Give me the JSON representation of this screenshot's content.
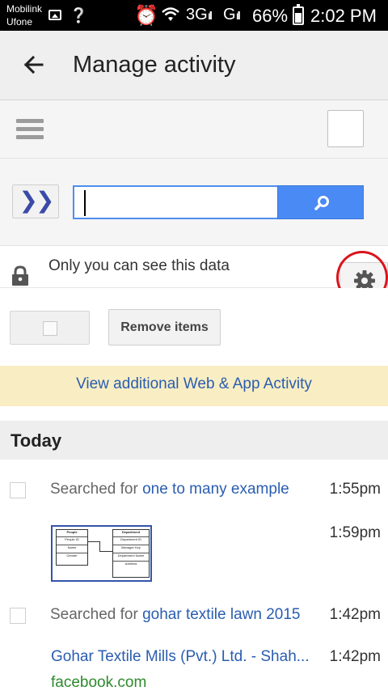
{
  "status_bar": {
    "carrier_line1": "Mobilink",
    "carrier_line2": "Ufone",
    "network_3g": "3G",
    "network_g": "G",
    "battery": "66%",
    "time": "2:02 PM"
  },
  "app_bar": {
    "title": "Manage activity"
  },
  "privacy": {
    "text": "Only you can see this data"
  },
  "actions": {
    "remove_label": "Remove items"
  },
  "banner": {
    "link": "View additional Web & App Activity"
  },
  "day_header": "Today",
  "items": [
    {
      "prefix": "Searched for ",
      "query": "one to many example",
      "time": "1:55pm"
    },
    {
      "time": "1:59pm"
    },
    {
      "prefix": "Searched for ",
      "query": "gohar textile lawn 2015",
      "time": "1:42pm"
    },
    {
      "title": "Gohar Textile Mills (Pvt.) Ltd. - Shah...",
      "domain": "facebook.com",
      "time": "1:42pm"
    }
  ],
  "thumbnail": {
    "left_table": {
      "header": "People",
      "rows": [
        "People ID",
        "Name",
        "Gender"
      ]
    },
    "right_table": {
      "header": "Department",
      "rows": [
        "Department ID",
        "Manager Key",
        "Department Name",
        "Address"
      ]
    }
  },
  "colors": {
    "accent_blue": "#4a8af4",
    "link_blue": "#2a5db0",
    "url_green": "#2d8a2d",
    "banner_bg": "#f9eec3",
    "annotation_red": "#d9141c"
  }
}
